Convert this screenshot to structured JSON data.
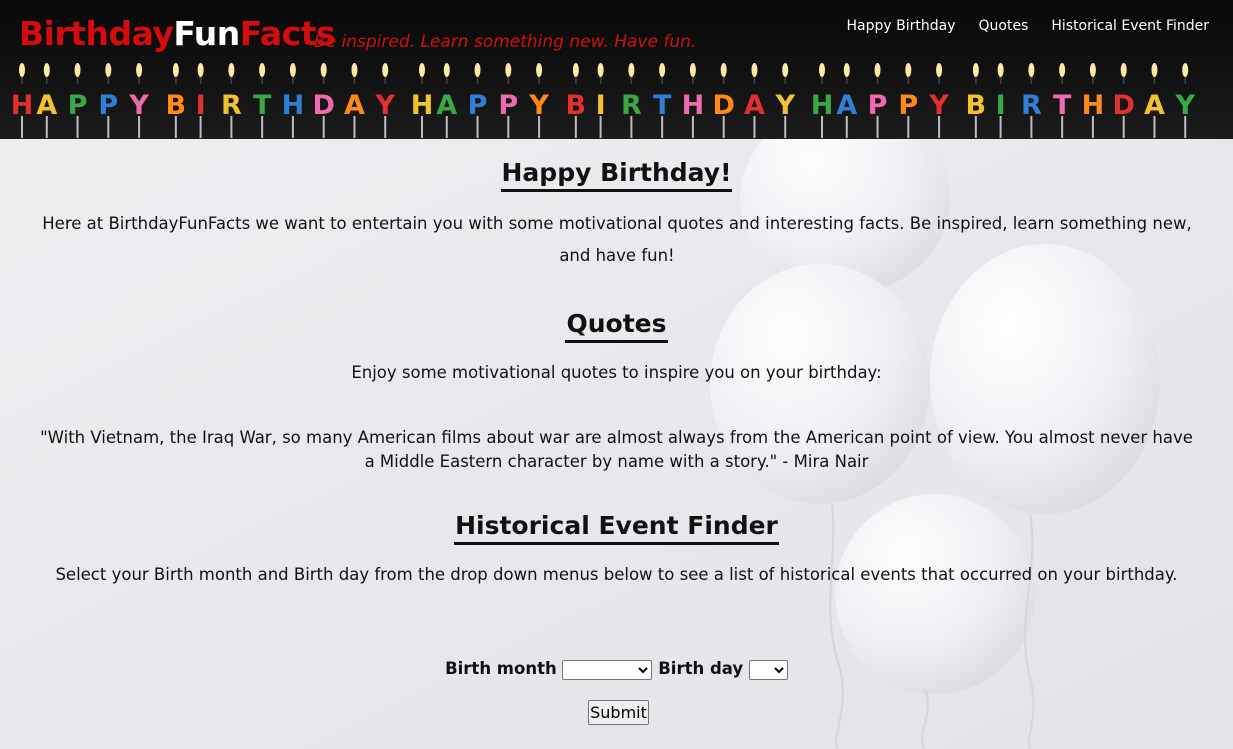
{
  "header": {
    "logo": {
      "part1": "Birthday",
      "part2": "Fun",
      "part3": "Facts"
    },
    "tagline": "Be inspired. Learn something new. Have fun.",
    "nav": [
      "Happy Birthday",
      "Quotes",
      "Historical Event Finder"
    ],
    "banner_letters": [
      "H",
      "A",
      "P",
      "P",
      "Y",
      "B",
      "I",
      "R",
      "T",
      "H",
      "D",
      "A",
      "Y",
      "H",
      "A",
      "P",
      "P",
      "Y",
      "B",
      "I",
      "R",
      "T",
      "H",
      "D",
      "A",
      "Y",
      "H",
      "A",
      "P",
      "P",
      "Y",
      "B",
      "I",
      "R",
      "T",
      "H",
      "D",
      "A",
      "Y"
    ]
  },
  "birthday_section": {
    "title": "Happy Birthday!",
    "text": "Here at BirthdayFunFacts we want to entertain you with some motivational quotes and interesting facts. Be inspired, learn something new, and have fun!"
  },
  "quotes_section": {
    "title": "Quotes",
    "intro": "Enjoy some motivational quotes to inspire you on your birthday:",
    "quote": "\"With Vietnam, the Iraq War, so many American films about war are almost always from the American point of view. You almost never have a Middle Eastern character by name with a story.\" - Mira Nair"
  },
  "event_finder": {
    "title": "Historical Event Finder",
    "instructions": "Select your Birth month and Birth day from the drop down menus below to see a list of historical events that occurred on your birthday.",
    "month_label": "Birth month",
    "day_label": "Birth day",
    "month_value": "",
    "day_value": "",
    "submit_label": "Submit"
  },
  "colors": {
    "brand_red": "#d60b0b",
    "header_bg": "#0b0b0b",
    "candle_colors": [
      "#e03030",
      "#f2c230",
      "#3aa845",
      "#2f7fd6",
      "#f06ab0",
      "#ff8a1a"
    ]
  }
}
